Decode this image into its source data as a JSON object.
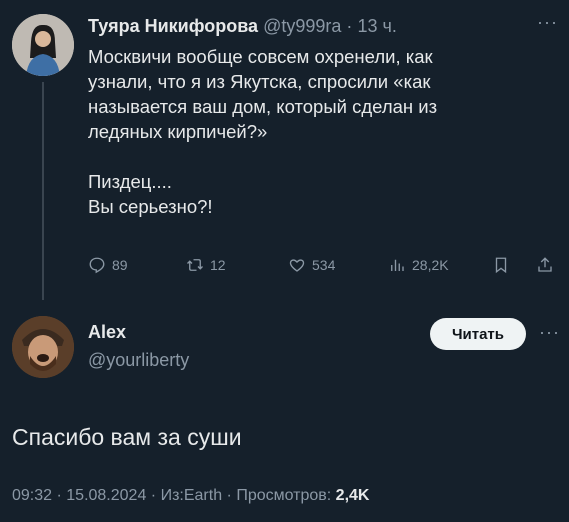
{
  "parent": {
    "author_name": "Туяра Никифорова",
    "handle": "@ty999ra",
    "separator": "·",
    "time": "13 ч.",
    "text_lines": [
      "Москвичи вообще совсем охренели, как",
      "узнали, что я из Якутска, спросили «как",
      "называется ваш дом, который сделан из",
      "ледяных кирпичей?»"
    ],
    "text_lines2": [
      "Пиздец....",
      "Вы серьезно?!"
    ],
    "actions": {
      "replies": "89",
      "reposts": "12",
      "likes": "534",
      "views": "28,2K"
    }
  },
  "reply": {
    "author_name": "Alex",
    "handle": "@yourliberty",
    "follow_label": "Читать",
    "text": "Спасибо вам за суши",
    "footer": {
      "time": "09:32",
      "sep1": " · ",
      "date": "15.08.2024",
      "sep2": " · ",
      "source": "Из:Earth",
      "sep3": " · ",
      "views_label": "Просмотров: ",
      "views_value": "2,4K"
    }
  },
  "more_symbol": "···",
  "colors": {
    "background": "#15202b",
    "text_primary": "#e7e9ea",
    "text_secondary": "#8b98a5",
    "button_bg": "#eff3f4"
  }
}
